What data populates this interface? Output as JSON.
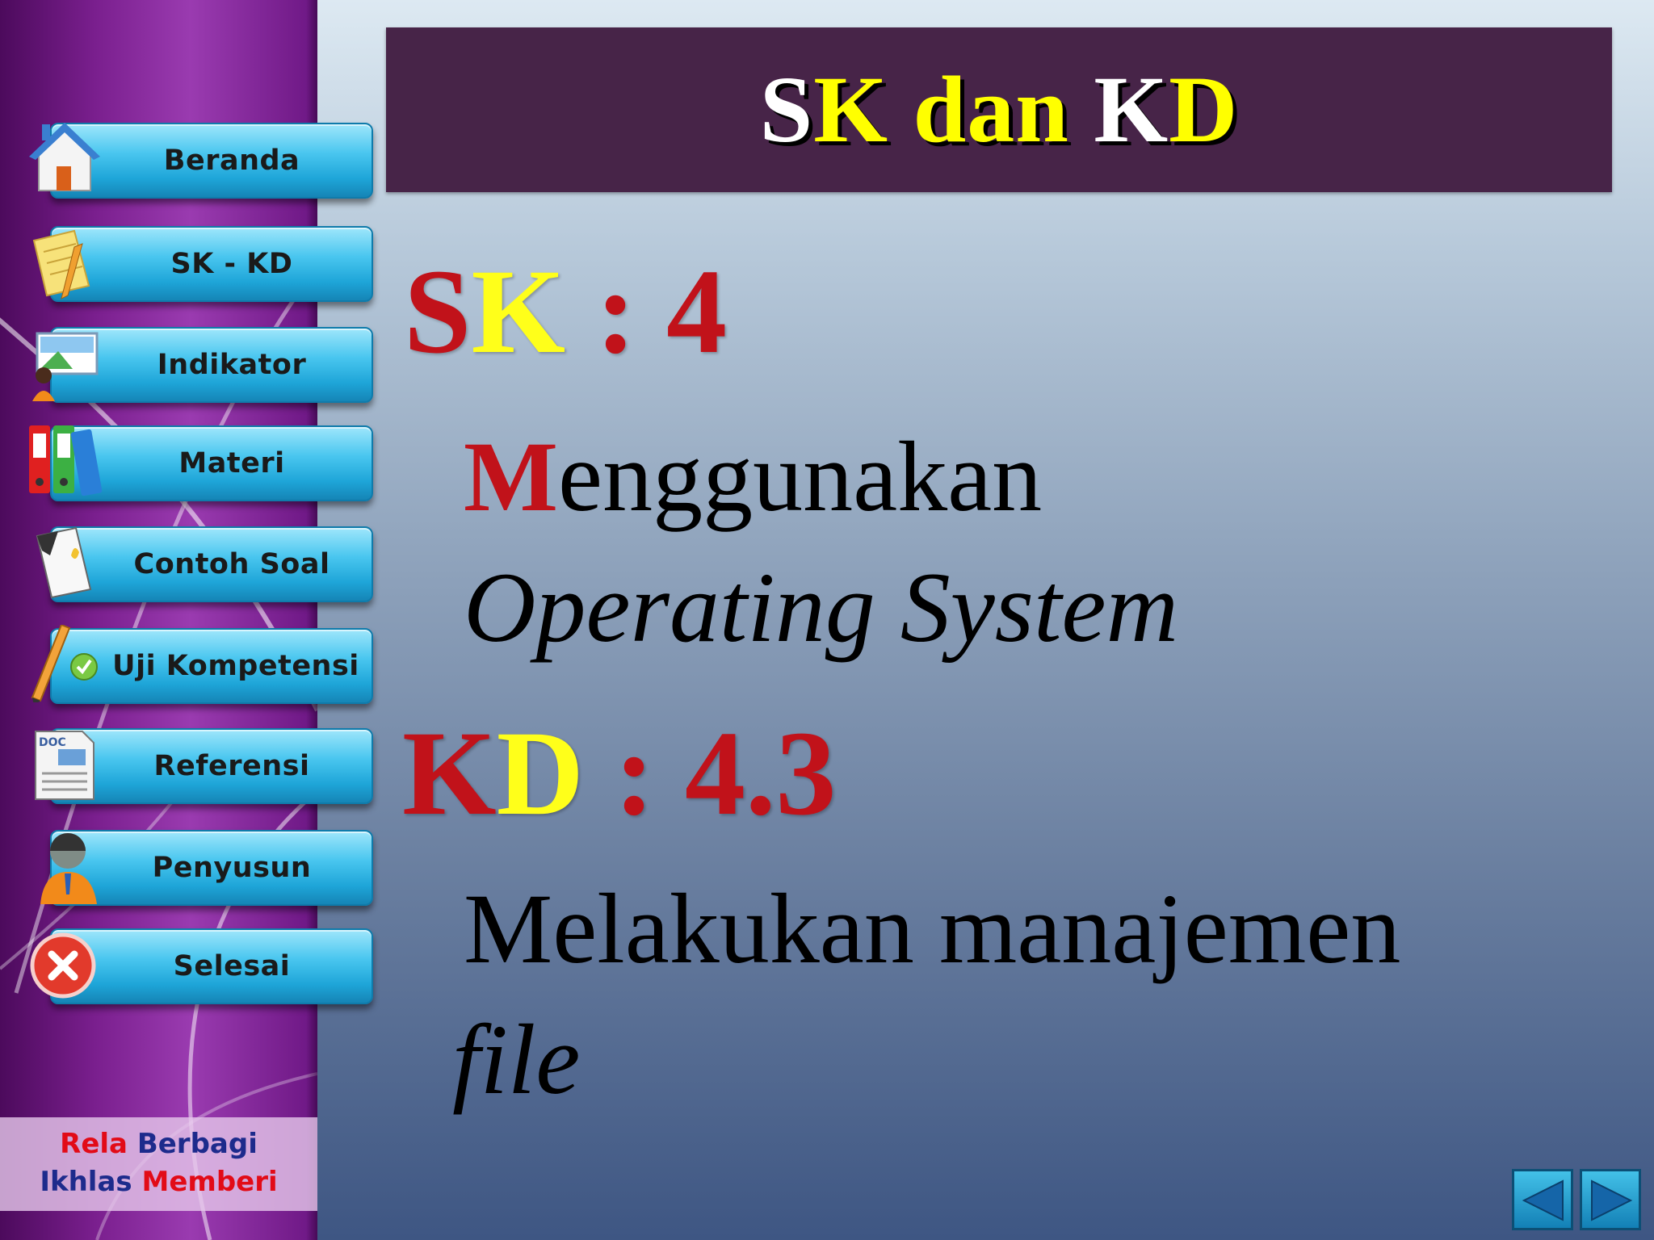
{
  "title": {
    "part1": "S",
    "part2": "K",
    "part3": " dan ",
    "part4": "K",
    "part5": "D"
  },
  "sk": {
    "label_s": "S",
    "label_k": "K",
    "sep_value": " : 4",
    "desc_first": "M",
    "desc_rest": "enggunakan",
    "desc_line2": "Operating System"
  },
  "kd": {
    "label_k": "K",
    "label_d": "D",
    "sep_value": " : 4.3",
    "desc_line1": "Melakukan manajemen",
    "desc_line2": "file"
  },
  "nav": [
    {
      "label": "Beranda",
      "icon": "house-icon"
    },
    {
      "label": "SK - KD",
      "icon": "notepad-pencil-icon"
    },
    {
      "label": "Indikator",
      "icon": "presenter-icon"
    },
    {
      "label": "Materi",
      "icon": "binders-icon"
    },
    {
      "label": "Contoh Soal",
      "icon": "document-icon"
    },
    {
      "label": "Uji Kompetensi",
      "icon": "pencil-check-icon"
    },
    {
      "label": "Referensi",
      "icon": "doc-file-icon"
    },
    {
      "label": "Penyusun",
      "icon": "person-icon"
    },
    {
      "label": "Selesai",
      "icon": "close-circle-icon"
    }
  ],
  "footer": {
    "w1": "Rela",
    "w2": "Berbagi",
    "w3": "Ikhlas",
    "w4": "Memberi"
  },
  "colors": {
    "accent_red": "#c1121a",
    "accent_yellow": "#ffff00",
    "title_bg": "#472448",
    "button_blue": "#1ea5d8"
  }
}
